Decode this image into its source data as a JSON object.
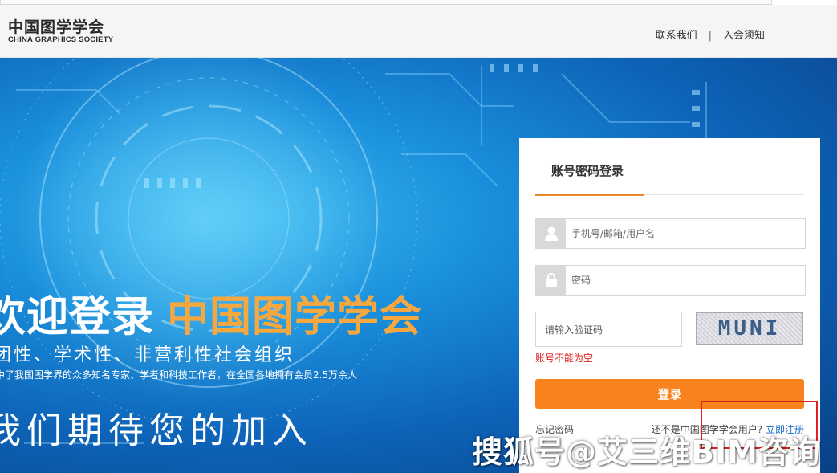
{
  "header": {
    "logo_cn": "中国图学学会",
    "logo_en": "CHINA GRAPHICS SOCIETY",
    "nav": {
      "contact": "联系我们",
      "separator": "|",
      "join_notice": "入会须知"
    }
  },
  "hero": {
    "title_white": "欢迎登录",
    "title_orange": "中国图学学会",
    "subtitle": "团性、学术性、非营利性社会组织",
    "description": "中了我国图学界的众多知名专家、学者和科技工作者，在全国各地拥有会员2.5万余人",
    "join": "我们期待您的加入"
  },
  "login": {
    "tab_label": "账号密码登录",
    "username_placeholder": "手机号/邮箱/用户名",
    "password_placeholder": "密码",
    "captcha_placeholder": "请输入验证码",
    "captcha_text": "MUNI",
    "error_text": "账号不能为空",
    "login_button": "登录",
    "forgot_password": "忘记密码",
    "register_prompt": "还不是中国图学学会用户?",
    "register_link": "立即注册"
  },
  "watermark": "搜狐号@艾三维BIM咨询",
  "colors": {
    "accent_orange": "#f7821e",
    "title_orange": "#f7a73f",
    "error_red": "#e02020",
    "link_blue": "#1a6fc7"
  },
  "icons": {
    "username": "user-icon",
    "password": "lock-icon"
  }
}
